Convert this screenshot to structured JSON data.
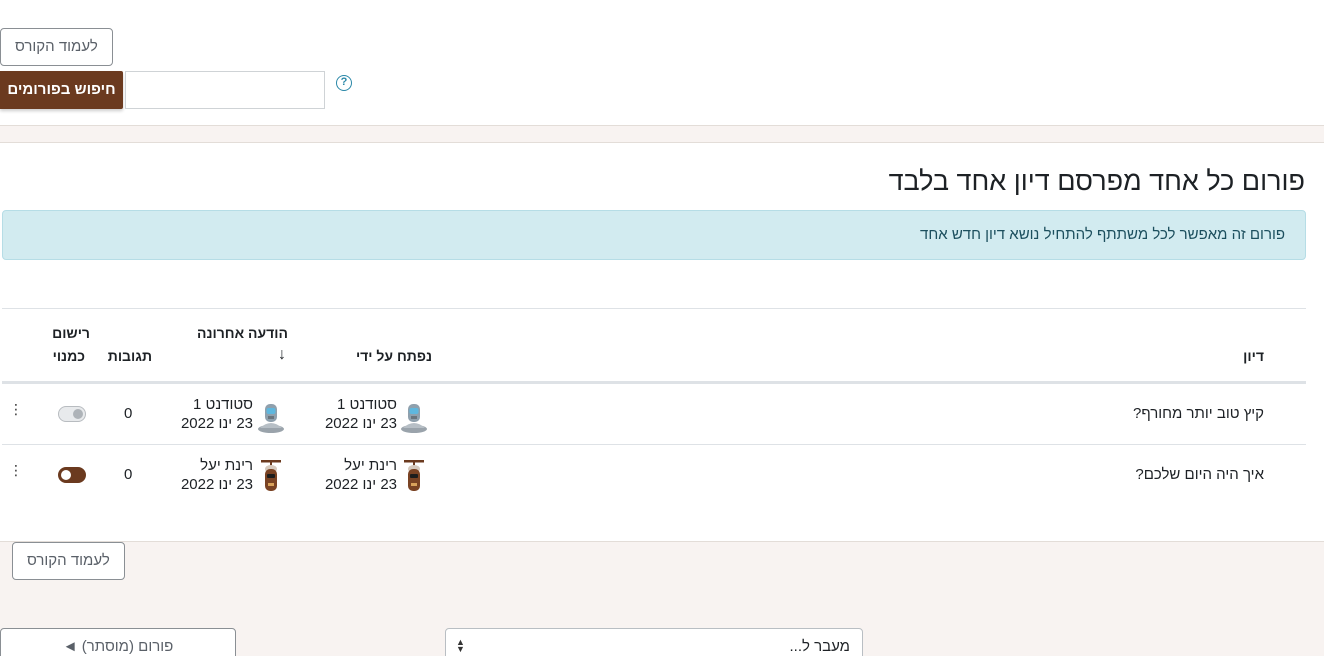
{
  "header": {
    "course_page_button": "לעמוד הקורס",
    "search_button": "חיפוש בפורומים",
    "search_placeholder": "",
    "help_icon": "?"
  },
  "forum": {
    "title": "פורום כל אחד מפרסם דיון אחד בלבד",
    "info": "פורום זה מאפשר לכל משתתף להתחיל נושא דיון חדש אחד"
  },
  "table": {
    "columns": {
      "discussion": "דיון",
      "started_by": "נפתח על ידי",
      "last_post": "הודעה אחרונה",
      "sort_arrow": "↓",
      "replies": "תגובות",
      "subscribe_line1": "רישום",
      "subscribe_line2": "כמנוי"
    },
    "rows": [
      {
        "subject": "קיץ טוב יותר מחורף?",
        "started_by_name": "סטודנט 1",
        "started_by_date": "23 ינו 2022",
        "last_post_name": "סטודנט 1",
        "last_post_date": "23 ינו 2022",
        "replies": "0",
        "subscribed": false,
        "avatar": "robot-avatar"
      },
      {
        "subject": "איך היה היום שלכם?",
        "started_by_name": "רינת יעל",
        "started_by_date": "23 ינו 2022",
        "last_post_name": "רינת יעל",
        "last_post_date": "23 ינו 2022",
        "replies": "0",
        "subscribed": true,
        "avatar": "propeller-avatar"
      }
    ],
    "kebab_icon": "⋮"
  },
  "footer": {
    "course_page_button": "לעמוד הקורס",
    "jump_to_placeholder": "מעבר ל...",
    "prev_forum_link": "פורום (מוסתר) ◄"
  },
  "colors": {
    "brand": "#6b3a1f",
    "info_bg": "#d2ebf0",
    "info_text": "#1c4f5e"
  }
}
